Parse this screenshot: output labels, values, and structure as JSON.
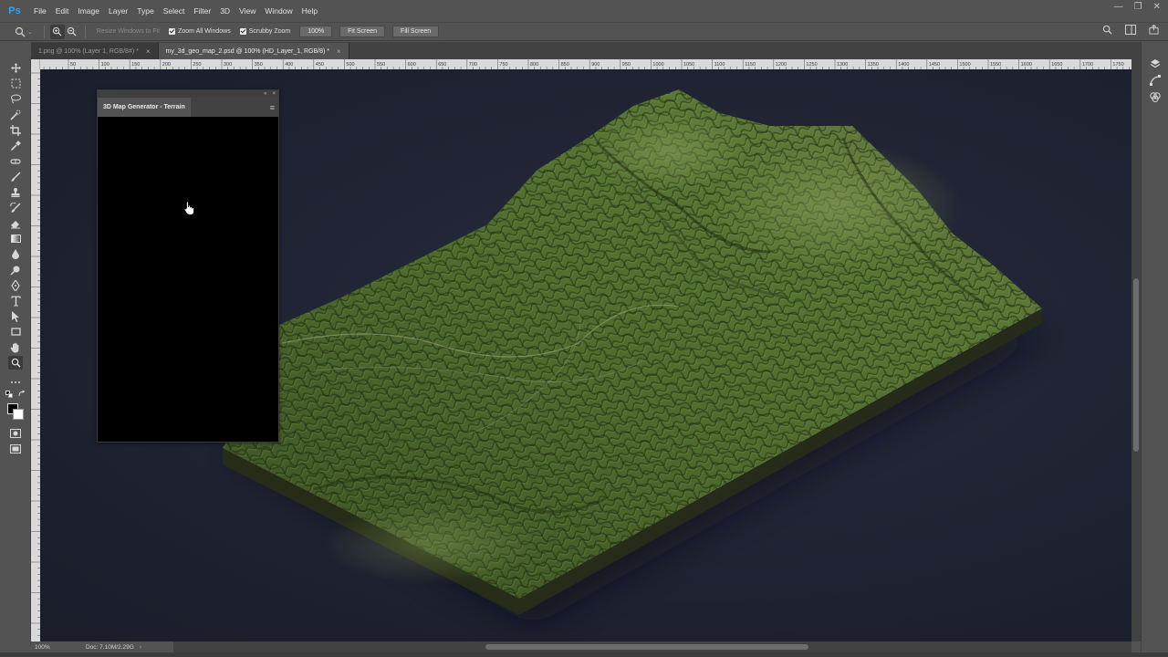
{
  "app": {
    "logo": "Ps"
  },
  "menu": [
    "File",
    "Edit",
    "Image",
    "Layer",
    "Type",
    "Select",
    "Filter",
    "3D",
    "View",
    "Window",
    "Help"
  ],
  "window_controls": {
    "minimize": "—",
    "restore": "❐",
    "close": "✕"
  },
  "options": {
    "resize_windows": "Resize Windows to Fit",
    "zoom_all_windows": "Zoom All Windows",
    "scrubby_zoom": "Scrubby Zoom",
    "zoom_value": "100%",
    "fit_screen": "Fit Screen",
    "fill_screen": "Fill Screen"
  },
  "tabs": [
    {
      "label": "1.png @ 100% (Layer 1, RGB/8#) *",
      "active": false
    },
    {
      "label": "my_3d_geo_map_2.psd @ 100% (HD_Layer_1, RGB/8) *",
      "active": true
    }
  ],
  "ruler_top": [
    "50",
    "100",
    "150",
    "200",
    "250",
    "300",
    "350",
    "400",
    "450",
    "500",
    "550",
    "600",
    "650",
    "700",
    "750",
    "800",
    "850",
    "900",
    "950",
    "1000",
    "1050",
    "1100",
    "1150",
    "1200",
    "1250",
    "1300",
    "1350",
    "1400",
    "1450",
    "1500",
    "1550",
    "1600",
    "1650",
    "1700",
    "1750"
  ],
  "panel": {
    "title": "3D Map Generator - Terrain"
  },
  "status": {
    "zoom": "100%",
    "doc": "Doc: 7.10M/2.29G"
  },
  "colors": {
    "canvas": "#1e2231",
    "terrain_dark": "#2c3a1e",
    "terrain_light": "#6f8a3e",
    "accent": "#2fa3f7"
  }
}
